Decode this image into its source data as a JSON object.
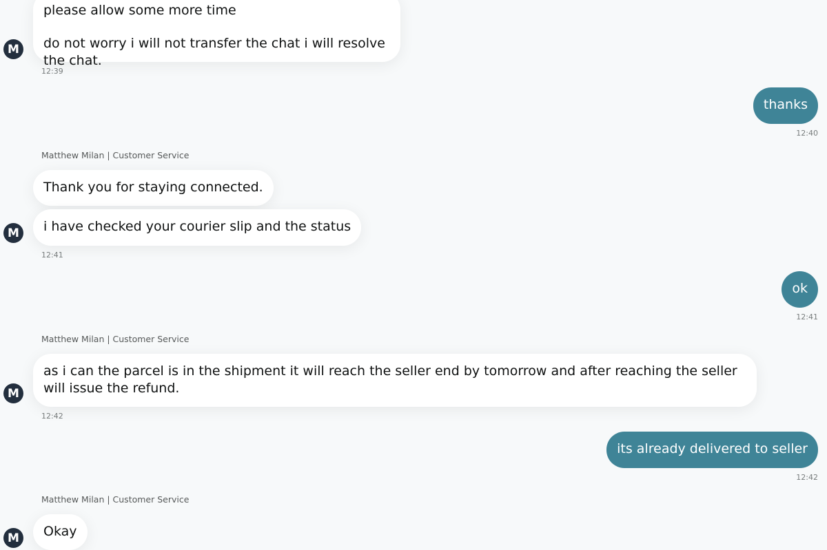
{
  "agent": {
    "avatar_letter": "M",
    "sender_label": "Matthew Milan | Customer Service"
  },
  "messages": [
    {
      "from": "agent",
      "lines": [
        "please allow some more time",
        "do not worry i will not transfer the chat i will resolve the chat."
      ],
      "time": "12:39"
    },
    {
      "from": "user",
      "text": "thanks",
      "time": "12:40"
    },
    {
      "from": "agent",
      "lines": [
        "Thank you for staying connected.",
        "i have checked your courier slip and the status"
      ],
      "time": "12:41"
    },
    {
      "from": "user",
      "text": "ok",
      "time": "12:41"
    },
    {
      "from": "agent",
      "lines": [
        "as i can the parcel is in the shipment it will reach the seller end by tomorrow and after reaching the seller will issue the refund."
      ],
      "time": "12:42"
    },
    {
      "from": "user",
      "text": "its already delivered to seller",
      "time": "12:42"
    },
    {
      "from": "agent",
      "lines": [
        "Okay"
      ],
      "time": ""
    }
  ],
  "colors": {
    "background": "#f7f9fa",
    "user_bubble": "#3f8497",
    "agent_bubble": "#ffffff",
    "avatar": "#232f3e"
  }
}
